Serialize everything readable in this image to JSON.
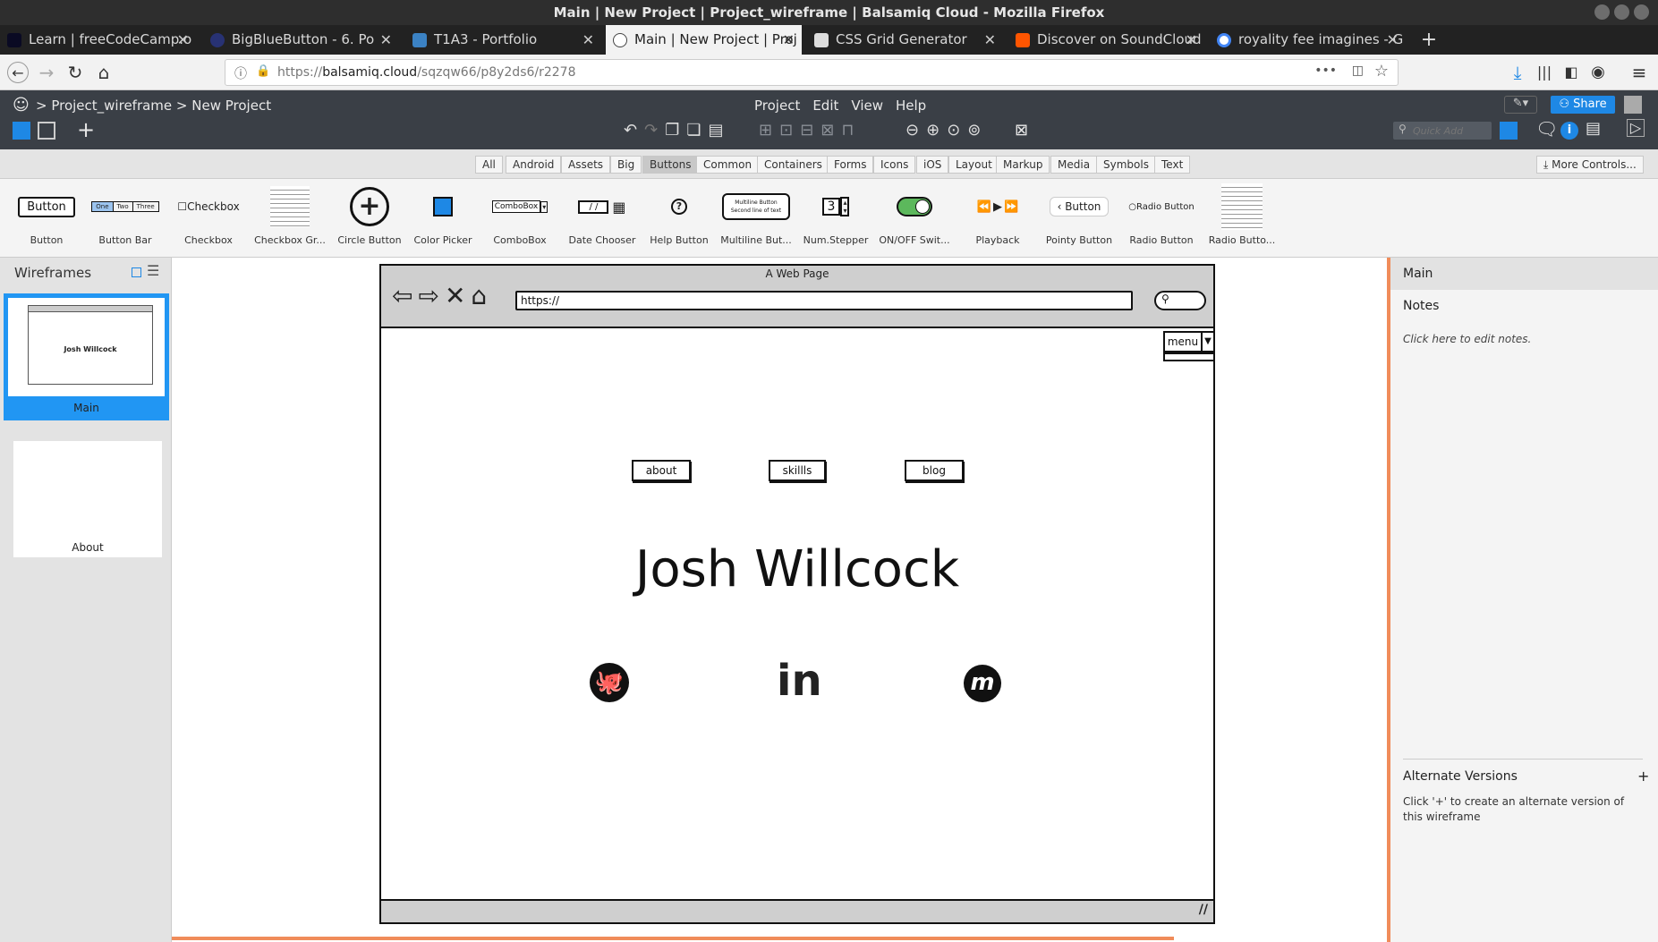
{
  "window": {
    "title": "Main | New Project | Project_wireframe | Balsamiq Cloud - Mozilla Firefox"
  },
  "tabs": [
    {
      "label": "Learn | freeCodeCamp.o"
    },
    {
      "label": "BigBlueButton - 6. Po"
    },
    {
      "label": "T1A3 - Portfolio"
    },
    {
      "label": "Main | New Project | Proj"
    },
    {
      "label": "CSS Grid Generator"
    },
    {
      "label": "Discover on SoundCloud"
    },
    {
      "label": "royality fee imagines - G"
    }
  ],
  "browser": {
    "url_prefix": "https://",
    "url_domain": "balsamiq.cloud",
    "url_path": "/sqzqw66/p8y2ds6/r2278"
  },
  "app": {
    "breadcrumb_project": "Project_wireframe",
    "breadcrumb_page": "New Project",
    "menus": [
      "Project",
      "Edit",
      "View",
      "Help"
    ],
    "share_label": "Share",
    "quick_add_placeholder": "Quick Add"
  },
  "filters": [
    "All",
    "Android",
    "Assets",
    "Big",
    "Buttons",
    "Common",
    "Containers",
    "Forms",
    "Icons",
    "iOS",
    "Layout",
    "Markup",
    "Media",
    "Symbols",
    "Text"
  ],
  "more_controls": "More Controls...",
  "controls": [
    "Button",
    "Button Bar",
    "Checkbox",
    "Checkbox Gr...",
    "Circle Button",
    "Color Picker",
    "ComboBox",
    "Date Chooser",
    "Help Button",
    "Multiline But...",
    "Num.Stepper",
    "ON/OFF Swit...",
    "Playback",
    "Pointy Button",
    "Radio Button",
    "Radio Butto..."
  ],
  "control_text": {
    "button": "Button",
    "bar_one": "One",
    "bar_two": "Two",
    "bar_three": "Three",
    "checkbox": "Checkbox",
    "combobox": "ComboBox",
    "date": "/ /",
    "multiline_1": "Multiline Button",
    "multiline_2": "Second line of text",
    "stepper": "3",
    "pointy": "Button",
    "radio": "Radio Button"
  },
  "left_panel": {
    "title": "Wireframes",
    "items": [
      {
        "label": "Main",
        "thumb_name": "Josh Willcock"
      },
      {
        "label": "About"
      }
    ]
  },
  "wireframe": {
    "window_title": "A Web Page",
    "url": "https://",
    "menu_label": "menu",
    "nav": [
      "about",
      "skillls",
      "blog"
    ],
    "name": "Josh Willcock"
  },
  "right_panel": {
    "title": "Main",
    "notes_label": "Notes",
    "notes_hint": "Click here to edit notes.",
    "alt_title": "Alternate Versions",
    "alt_plus": "+",
    "alt_hint": "Click '+' to create an alternate version of this wireframe"
  },
  "colors": {
    "accent": "#1e88e5",
    "brand_orange": "#f08c5a",
    "toolbar_dark": "#3a3f46",
    "toggle_green": "#5cb85c"
  }
}
